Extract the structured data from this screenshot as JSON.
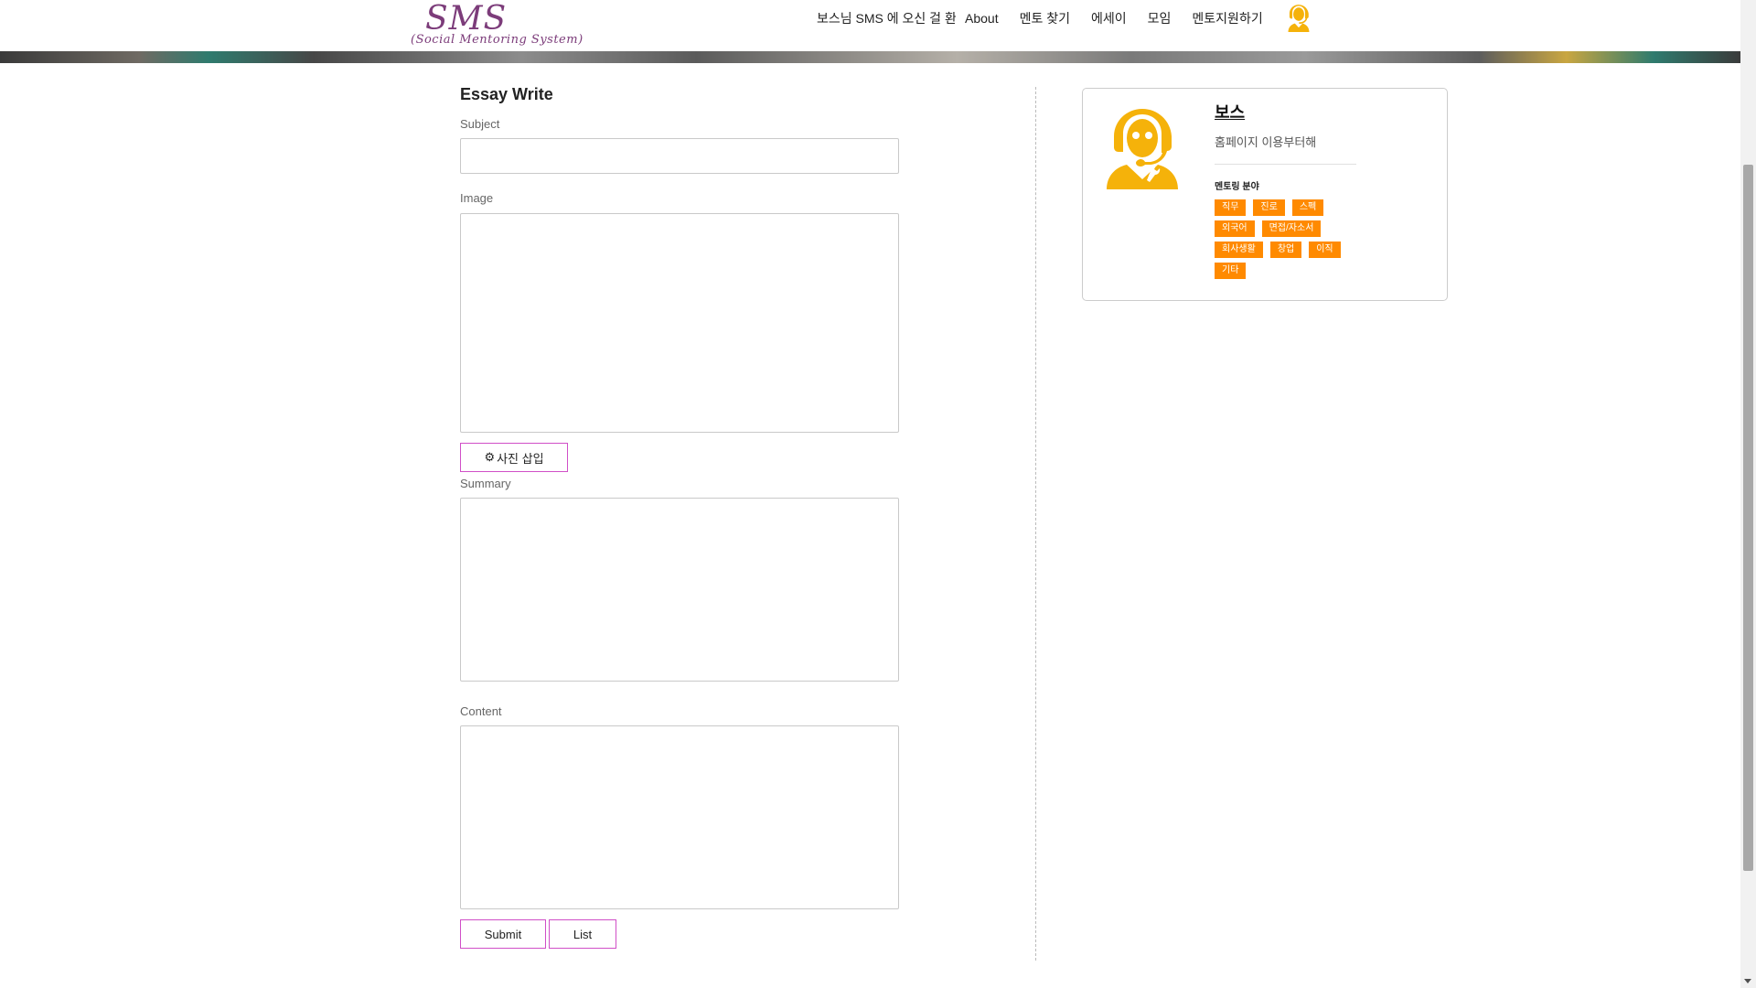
{
  "header": {
    "logo_main": "SMS",
    "logo_sub": "(Social Mentoring System)",
    "welcome": "보스님 SMS 에 오신 걸 환영합니다",
    "nav": [
      "About",
      "멘토 찾기",
      "에세이",
      "모임",
      "멘토지원하기"
    ]
  },
  "form": {
    "title": "Essay Write",
    "subject_label": "Subject",
    "subject_value": "",
    "image_label": "Image",
    "insert_photo_label": "사진 삽입",
    "summary_label": "Summary",
    "summary_value": "",
    "content_label": "Content",
    "content_value": "",
    "submit_label": "Submit",
    "list_label": "List"
  },
  "profile": {
    "name": "보스",
    "intro": "홈페이지 이용부터해",
    "field_title": "멘토링 분야",
    "tags": [
      "직무",
      "진로",
      "스펙",
      "외국어",
      "면접/자소서",
      "회사생활",
      "창업",
      "이직",
      "기타"
    ]
  },
  "colors": {
    "accent_border": "#d04fc7",
    "tag_bg": "#ff8a00",
    "avatar": "#f5b20a",
    "logo": "#7c3c7a"
  },
  "icons": {
    "user": "support-agent-icon",
    "insert_photo": "gear-icon"
  }
}
